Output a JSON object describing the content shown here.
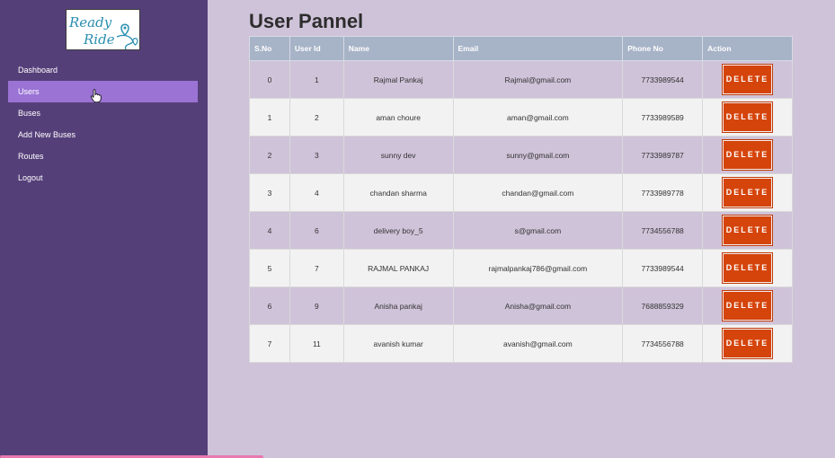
{
  "logo": {
    "text_top": "Ready",
    "text_bottom": "Ride"
  },
  "sidebar": {
    "items": [
      {
        "label": "Dashboard"
      },
      {
        "label": "Users"
      },
      {
        "label": "Buses"
      },
      {
        "label": "Add New Buses"
      },
      {
        "label": "Routes"
      },
      {
        "label": "Logout"
      }
    ]
  },
  "page": {
    "title": "User Pannel"
  },
  "table": {
    "headers": [
      "S.No",
      "User Id",
      "Name",
      "Email",
      "Phone No",
      "Action"
    ],
    "action_label": "DELETE",
    "rows": [
      {
        "sno": "0",
        "id": "1",
        "name": "Rajmal Pankaj",
        "email": "Rajmal@gmail.com",
        "phone": "7733989544"
      },
      {
        "sno": "1",
        "id": "2",
        "name": "aman choure",
        "email": "aman@gmail.com",
        "phone": "7733989589"
      },
      {
        "sno": "2",
        "id": "3",
        "name": "sunny dev",
        "email": "sunny@gmail.com",
        "phone": "7733989787"
      },
      {
        "sno": "3",
        "id": "4",
        "name": "chandan sharma",
        "email": "chandan@gmail.com",
        "phone": "7733989778"
      },
      {
        "sno": "4",
        "id": "6",
        "name": "delivery boy_5",
        "email": "s@gmail.com",
        "phone": "7734556788"
      },
      {
        "sno": "5",
        "id": "7",
        "name": "RAJMAL PANKAJ",
        "email": "rajmalpankaj786@gmail.com",
        "phone": "7733989544"
      },
      {
        "sno": "6",
        "id": "9",
        "name": "Anisha pankaj",
        "email": "Anisha@gmail.com",
        "phone": "7688859329"
      },
      {
        "sno": "7",
        "id": "11",
        "name": "avanish kumar",
        "email": "avanish@gmail.com",
        "phone": "7734556788"
      }
    ]
  },
  "colors": {
    "sidebar_bg": "#553f79",
    "active_item": "#9b73d4",
    "page_bg": "#cfc3d9",
    "header_bg": "#a7b3c7",
    "delete_button": "#d5440b"
  }
}
